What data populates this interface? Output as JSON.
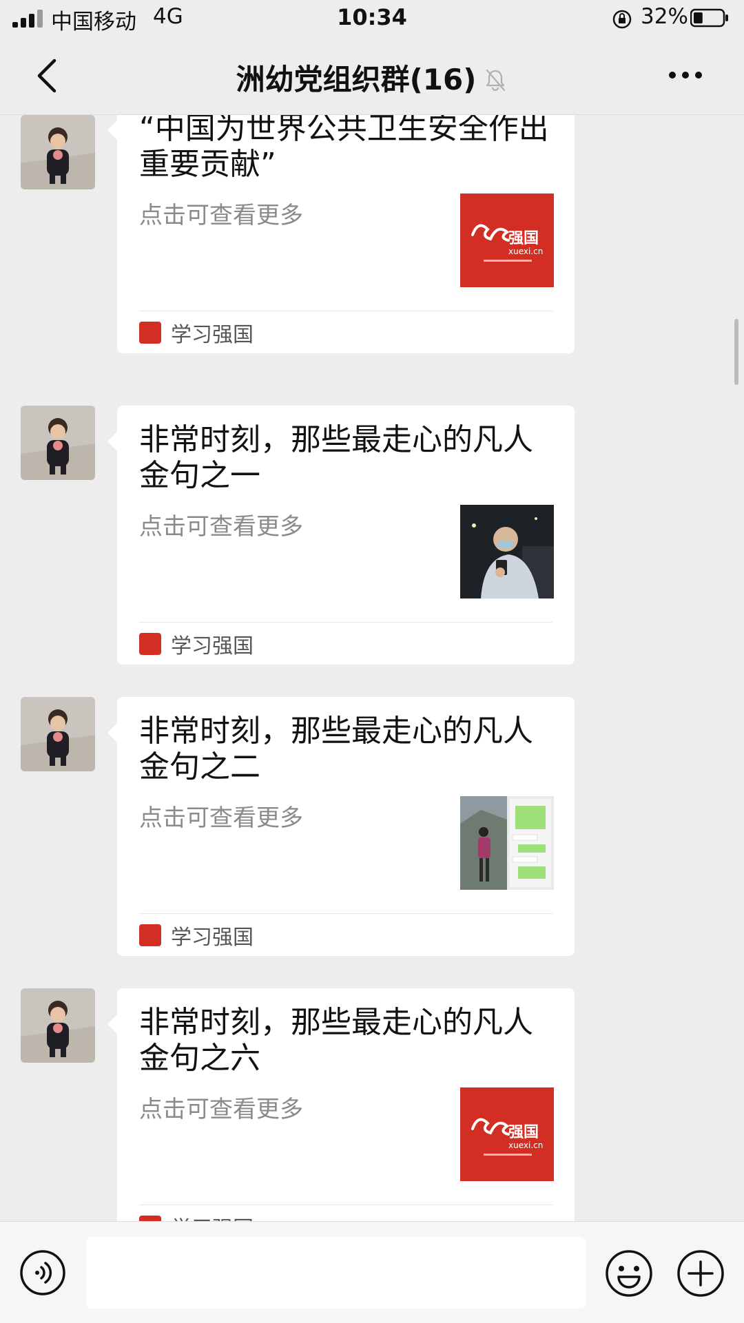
{
  "status_bar": {
    "carrier": "中国移动",
    "network": "4G",
    "time": "10:34",
    "battery_percent": "32%",
    "battery_level": 0.32
  },
  "nav": {
    "title": "洲幼党组织群(16)",
    "back_icon": "chevron-left-icon",
    "mute_icon": "bell-muted-icon",
    "more_icon": "more-dots-icon"
  },
  "messages": [
    {
      "title": "“中国为世界公共卫生安全作出重要贡献”",
      "desc": "点击可查看更多",
      "source": "学习强国",
      "thumb": "xuexi-logo"
    },
    {
      "title": "非常时刻，那些最走心的凡人金句之一",
      "desc": "点击可查看更多",
      "source": "学习强国",
      "thumb": "photo-man-phone"
    },
    {
      "title": "非常时刻，那些最走心的凡人金句之二",
      "desc": "点击可查看更多",
      "source": "学习强国",
      "thumb": "photo-chat-screenshot"
    },
    {
      "title": "非常时刻，那些最走心的凡人金句之六",
      "desc": "点击可查看更多",
      "source": "学习强国",
      "thumb": "xuexi-logo"
    }
  ],
  "logo": {
    "brand_text": "强国",
    "url_text": "xuexi.cn"
  },
  "input_bar": {
    "voice_icon": "voice-icon",
    "emoji_icon": "emoji-icon",
    "plus_icon": "plus-icon",
    "placeholder": ""
  },
  "colors": {
    "background": "#ededed",
    "card": "#ffffff",
    "xuexi_red": "#d22e23",
    "desc_gray": "#8a8a8a"
  }
}
